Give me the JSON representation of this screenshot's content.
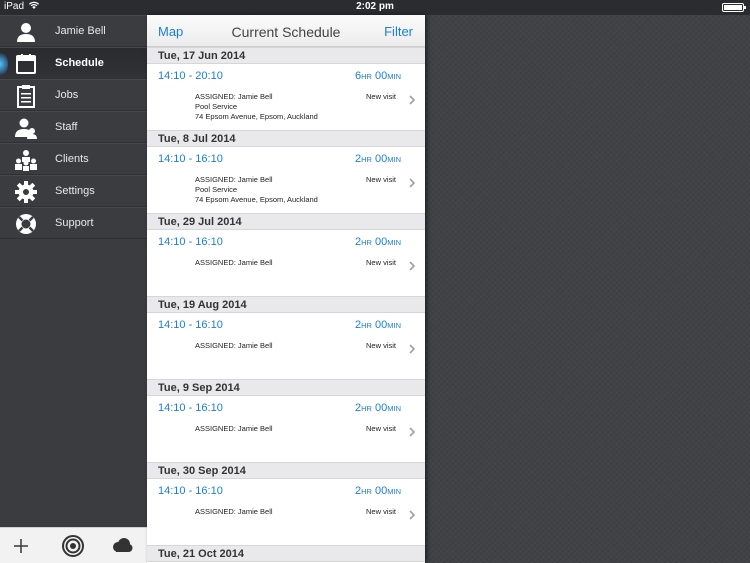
{
  "status_bar": {
    "carrier": "iPad",
    "time": "2:02 pm",
    "battery_level": 1.0
  },
  "sidebar": {
    "items": [
      {
        "label": "Jamie Bell",
        "icon": "user-icon",
        "active": false
      },
      {
        "label": "Schedule",
        "icon": "calendar-icon",
        "active": true
      },
      {
        "label": "Jobs",
        "icon": "clipboard-icon",
        "active": false
      },
      {
        "label": "Staff",
        "icon": "staff-icon",
        "active": false
      },
      {
        "label": "Clients",
        "icon": "clients-icon",
        "active": false
      },
      {
        "label": "Settings",
        "icon": "gear-icon",
        "active": false
      },
      {
        "label": "Support",
        "icon": "lifebuoy-icon",
        "active": false
      }
    ],
    "toolbar": {
      "add_icon": "plus-icon",
      "target_icon": "target-icon",
      "cloud_icon": "cloud-icon"
    }
  },
  "navbar": {
    "left": "Map",
    "title": "Current Schedule",
    "right": "Filter"
  },
  "schedule": [
    {
      "date": "Tue, 17 Jun 2014",
      "time": "14:10 - 20:10",
      "hours": "6",
      "minutes": "00",
      "hr_unit": "HR",
      "min_unit": "MIN",
      "assigned": "ASSIGNED: Jamie Bell",
      "service": "Pool Service",
      "address": "74 Epsom Avenue, Epsom, Auckland",
      "status": "New visit"
    },
    {
      "date": "Tue, 8 Jul 2014",
      "time": "14:10 - 16:10",
      "hours": "2",
      "minutes": "00",
      "hr_unit": "HR",
      "min_unit": "MIN",
      "assigned": "ASSIGNED: Jamie Bell",
      "service": "Pool Service",
      "address": "74 Epsom Avenue, Epsom, Auckland",
      "status": "New visit"
    },
    {
      "date": "Tue, 29 Jul 2014",
      "time": "14:10 - 16:10",
      "hours": "2",
      "minutes": "00",
      "hr_unit": "HR",
      "min_unit": "MIN",
      "assigned": "ASSIGNED: Jamie Bell",
      "service": "",
      "address": "",
      "status": "New visit"
    },
    {
      "date": "Tue, 19 Aug 2014",
      "time": "14:10 - 16:10",
      "hours": "2",
      "minutes": "00",
      "hr_unit": "HR",
      "min_unit": "MIN",
      "assigned": "ASSIGNED: Jamie Bell",
      "service": "",
      "address": "",
      "status": "New visit"
    },
    {
      "date": "Tue, 9 Sep 2014",
      "time": "14:10 - 16:10",
      "hours": "2",
      "minutes": "00",
      "hr_unit": "HR",
      "min_unit": "MIN",
      "assigned": "ASSIGNED: Jamie Bell",
      "service": "",
      "address": "",
      "status": "New visit"
    },
    {
      "date": "Tue, 30 Sep 2014",
      "time": "14:10 - 16:10",
      "hours": "2",
      "minutes": "00",
      "hr_unit": "HR",
      "min_unit": "MIN",
      "assigned": "ASSIGNED: Jamie Bell",
      "service": "",
      "address": "",
      "status": "New visit"
    },
    {
      "date": "Tue, 21 Oct 2014"
    }
  ],
  "colors": {
    "accent": "#1a7fd4",
    "sidebar_bg": "#3a3c40",
    "section_bg": "#e9e9ec",
    "glow": "#62c6ff"
  }
}
